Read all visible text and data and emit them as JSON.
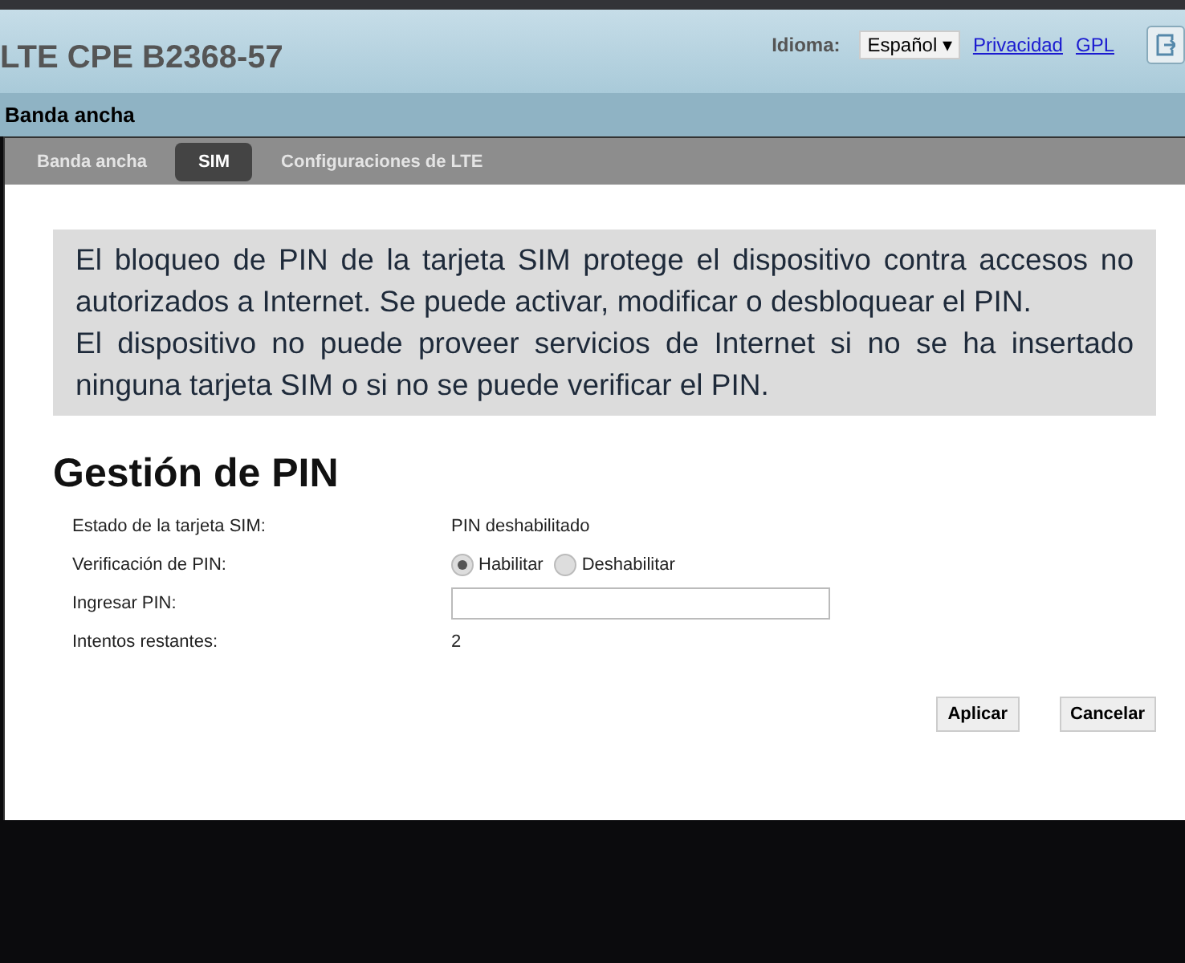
{
  "header": {
    "title": "LTE CPE B2368-57",
    "language_label": "Idioma:",
    "language": "Español ▾",
    "links": [
      "Privacidad",
      "GPL"
    ]
  },
  "section_title": "Banda ancha",
  "tabs": [
    {
      "label": "Banda ancha",
      "selected": false
    },
    {
      "label": "SIM",
      "selected": true
    },
    {
      "label": "Configuraciones de LTE",
      "selected": false
    }
  ],
  "info": [
    "El bloqueo de PIN de la tarjeta SIM protege el dispositivo contra accesos no autorizados a Internet. Se puede activar, modificar o desbloquear el PIN.",
    "El dispositivo no puede proveer servicios de Internet si no se ha insertado ninguna tarjeta SIM o si no se puede verificar el PIN."
  ],
  "heading": "Gestión de PIN",
  "rows": [
    {
      "kind": "text",
      "label": "Estado de la tarjeta SIM:",
      "value": "PIN deshabilitado"
    },
    {
      "kind": "radio",
      "label": "Verificación de PIN:",
      "options": [
        {
          "label": "Habilitar",
          "selected": true
        },
        {
          "label": "Deshabilitar",
          "selected": false
        }
      ]
    },
    {
      "kind": "input",
      "label": "Ingresar PIN:"
    },
    {
      "kind": "text",
      "label": "Intentos restantes:",
      "value": "2"
    }
  ],
  "buttons": [
    "Aplicar",
    "Cancelar"
  ]
}
